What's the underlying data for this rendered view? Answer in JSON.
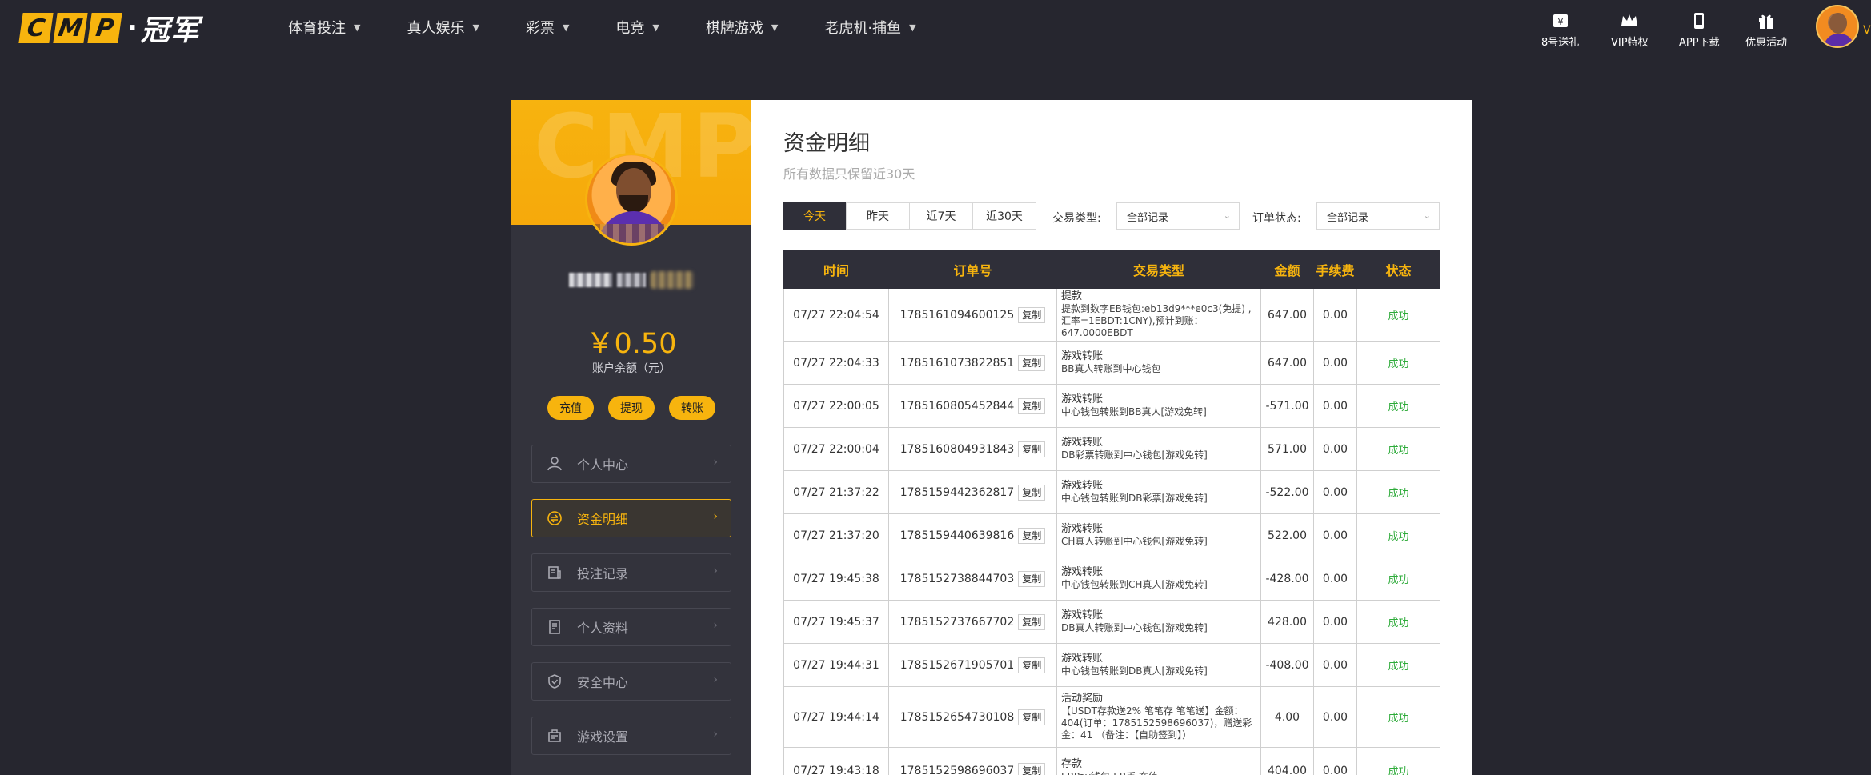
{
  "brand": {
    "logo_letters": [
      "C",
      "M",
      "P"
    ],
    "logo_dot": "·",
    "logo_cn": "冠军"
  },
  "nav": {
    "items": [
      {
        "label": "体育投注"
      },
      {
        "label": "真人娱乐"
      },
      {
        "label": "彩票"
      },
      {
        "label": "电竞"
      },
      {
        "label": "棋牌游戏"
      },
      {
        "label": "老虎机·捕鱼"
      }
    ]
  },
  "quick_links": [
    {
      "label": "8号送礼",
      "icon": "ticket-icon"
    },
    {
      "label": "VIP特权",
      "icon": "crown-icon"
    },
    {
      "label": "APP下载",
      "icon": "phone-icon"
    },
    {
      "label": "优惠活动",
      "icon": "gift-icon"
    }
  ],
  "header_edge_text": "V",
  "sidebar": {
    "watermark": "CMP",
    "balance": "￥0.50",
    "balance_label": "账户余额（元）",
    "actions": [
      "充值",
      "提现",
      "转账"
    ],
    "menu": [
      {
        "label": "个人中心",
        "icon": "user-icon",
        "active": false
      },
      {
        "label": "资金明细",
        "icon": "wallet-icon",
        "active": true
      },
      {
        "label": "投注记录",
        "icon": "bet-record-icon",
        "active": false
      },
      {
        "label": "个人资料",
        "icon": "profile-doc-icon",
        "active": false
      },
      {
        "label": "安全中心",
        "icon": "shield-icon",
        "active": false
      },
      {
        "label": "游戏设置",
        "icon": "game-settings-icon",
        "active": false
      }
    ]
  },
  "main": {
    "title": "资金明细",
    "subtitle": "所有数据只保留近30天",
    "range_tabs": [
      {
        "label": "今天",
        "active": true
      },
      {
        "label": "昨天",
        "active": false
      },
      {
        "label": "近7天",
        "active": false
      },
      {
        "label": "近30天",
        "active": false
      }
    ],
    "filters": {
      "type_label": "交易类型:",
      "type_value": "全部记录",
      "status_label": "订单状态:",
      "status_value": "全部记录"
    },
    "copy_label": "复制",
    "table": {
      "headers": [
        "时间",
        "订单号",
        "交易类型",
        "金额",
        "手续费",
        "状态"
      ],
      "rows": [
        {
          "time": "07/27 22:04:54",
          "order": "1785161094600125",
          "type": "提款",
          "desc": "提款到数字EB钱包:eb13d9***e0c3(免提) ,汇率=1EBDT:1CNY),预计到账：647.0000EBDT",
          "amount": "647.00",
          "fee": "0.00",
          "status": "成功"
        },
        {
          "time": "07/27 22:04:33",
          "order": "1785161073822851",
          "type": "游戏转账",
          "desc": "BB真人转账到中心钱包",
          "amount": "647.00",
          "fee": "0.00",
          "status": "成功"
        },
        {
          "time": "07/27 22:00:05",
          "order": "1785160805452844",
          "type": "游戏转账",
          "desc": "中心钱包转账到BB真人[游戏免转]",
          "amount": "-571.00",
          "fee": "0.00",
          "status": "成功"
        },
        {
          "time": "07/27 22:00:04",
          "order": "1785160804931843",
          "type": "游戏转账",
          "desc": "DB彩票转账到中心钱包[游戏免转]",
          "amount": "571.00",
          "fee": "0.00",
          "status": "成功"
        },
        {
          "time": "07/27 21:37:22",
          "order": "1785159442362817",
          "type": "游戏转账",
          "desc": "中心钱包转账到DB彩票[游戏免转]",
          "amount": "-522.00",
          "fee": "0.00",
          "status": "成功"
        },
        {
          "time": "07/27 21:37:20",
          "order": "1785159440639816",
          "type": "游戏转账",
          "desc": "CH真人转账到中心钱包[游戏免转]",
          "amount": "522.00",
          "fee": "0.00",
          "status": "成功"
        },
        {
          "time": "07/27 19:45:38",
          "order": "1785152738844703",
          "type": "游戏转账",
          "desc": "中心钱包转账到CH真人[游戏免转]",
          "amount": "-428.00",
          "fee": "0.00",
          "status": "成功"
        },
        {
          "time": "07/27 19:45:37",
          "order": "1785152737667702",
          "type": "游戏转账",
          "desc": "DB真人转账到中心钱包[游戏免转]",
          "amount": "428.00",
          "fee": "0.00",
          "status": "成功"
        },
        {
          "time": "07/27 19:44:31",
          "order": "1785152671905701",
          "type": "游戏转账",
          "desc": "中心钱包转账到DB真人[游戏免转]",
          "amount": "-408.00",
          "fee": "0.00",
          "status": "成功"
        },
        {
          "time": "07/27 19:44:14",
          "order": "1785152654730108",
          "type": "活动奖励",
          "desc": "【USDT存款送2% 笔笔存 笔笔送】金额：404(订单：1785152598696037)，赠送彩金：41 （备注：【自助签到】）",
          "amount": "4.00",
          "fee": "0.00",
          "status": "成功"
        },
        {
          "time": "07/27 19:43:18",
          "order": "1785152598696037",
          "type": "存款",
          "desc": "EBPay钱包-EB币 充值",
          "amount": "404.00",
          "fee": "0.00",
          "status": "成功"
        }
      ]
    }
  },
  "colors": {
    "accent": "#f7b40e",
    "dark_bg": "#26262f",
    "panel_bg": "#33333c",
    "success": "#2eab3a"
  }
}
